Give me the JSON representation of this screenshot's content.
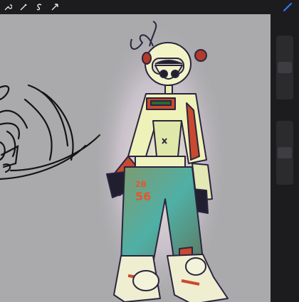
{
  "app": {
    "toolbar": {
      "tools": [
        {
          "name": "wrench-icon"
        },
        {
          "name": "magic-wand-icon"
        },
        {
          "name": "selection-s-icon"
        },
        {
          "name": "transform-arrow-icon"
        }
      ],
      "active_tool": "brush-icon",
      "accent_color": "#2f7cf6"
    },
    "sidebar": {
      "brush_size_level": 0.5,
      "opacity_level": 0.5
    },
    "canvas": {
      "background": "#aaaaac"
    }
  }
}
